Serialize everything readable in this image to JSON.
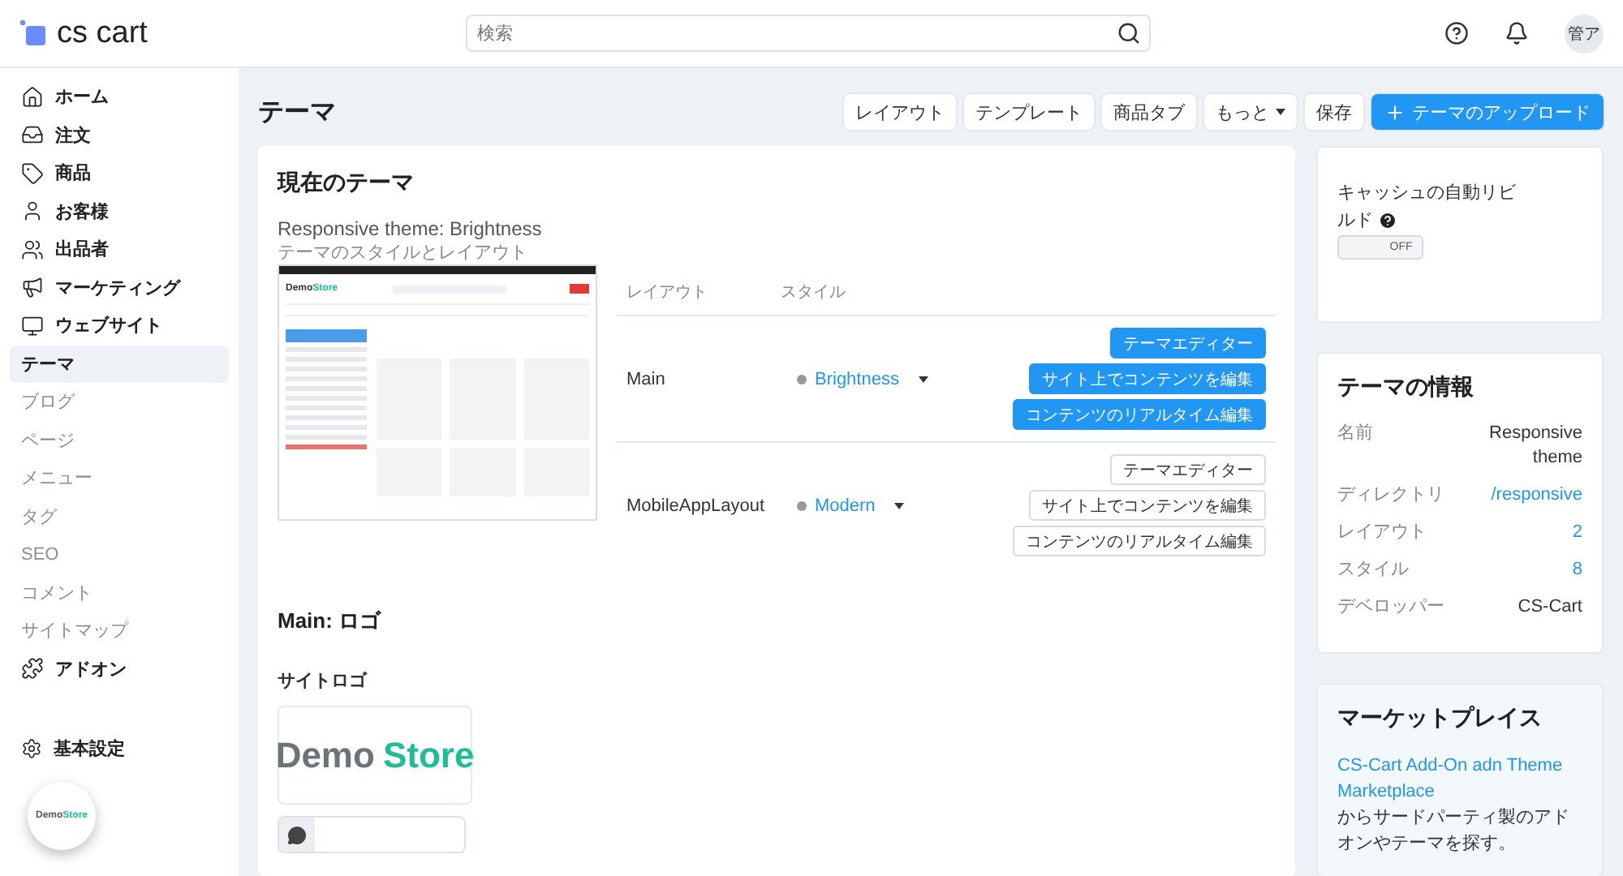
{
  "header": {
    "logo": "cs cart",
    "search": {
      "placeholder": "検索"
    },
    "avatar": "管ア"
  },
  "sidebar": {
    "items": [
      {
        "label": "ホーム",
        "kind": "main",
        "selected": false
      },
      {
        "label": "注文",
        "kind": "main",
        "selected": false
      },
      {
        "label": "商品",
        "kind": "main",
        "selected": false
      },
      {
        "label": "お客様",
        "kind": "main",
        "selected": false
      },
      {
        "label": "出品者",
        "kind": "main",
        "selected": false
      },
      {
        "label": "マーケティング",
        "kind": "main",
        "selected": false
      },
      {
        "label": "ウェブサイト",
        "kind": "main",
        "selected": false
      },
      {
        "label": "テーマ",
        "kind": "sub",
        "selected": true
      },
      {
        "label": "ブログ",
        "kind": "sub",
        "selected": false
      },
      {
        "label": "ページ",
        "kind": "sub",
        "selected": false
      },
      {
        "label": "メニュー",
        "kind": "sub",
        "selected": false
      },
      {
        "label": "タグ",
        "kind": "sub",
        "selected": false
      },
      {
        "label": "SEO",
        "kind": "sub",
        "selected": false
      },
      {
        "label": "コメント",
        "kind": "sub",
        "selected": false
      },
      {
        "label": "サイトマップ",
        "kind": "sub",
        "selected": false
      },
      {
        "label": "アドオン",
        "kind": "main",
        "selected": false
      }
    ],
    "settings": "基本設定",
    "store_badge": [
      "Demo",
      "Store"
    ]
  },
  "page": {
    "title": "テーマ",
    "toolbar": [
      {
        "label": "レイアウト",
        "kind": "plain"
      },
      {
        "label": "テンプレート",
        "kind": "plain"
      },
      {
        "label": "商品タブ",
        "kind": "plain"
      },
      {
        "label": "もっと",
        "kind": "dropdown"
      },
      {
        "label": "保存",
        "kind": "plain"
      },
      {
        "label": "テーマのアップロード",
        "kind": "primary"
      }
    ]
  },
  "current_theme": {
    "title": "現在のテーマ",
    "name": "Responsive theme: Brightness",
    "subtitle": "テーマのスタイルとレイアウト",
    "preview_logo": [
      "Demo",
      "Store"
    ],
    "columns": [
      "レイアウト",
      "スタイル"
    ],
    "rows": [
      {
        "layout": "Main",
        "style": "Brightness",
        "primary": true,
        "buttons": [
          "テーマエディター",
          "サイト上でコンテンツを編集",
          "コンテンツのリアルタイム編集"
        ]
      },
      {
        "layout": "MobileAppLayout",
        "style": "Modern",
        "primary": false,
        "buttons": [
          "テーマエディター",
          "サイト上でコンテンツを編集",
          "コンテンツのリアルタイム編集"
        ]
      }
    ]
  },
  "logo_section": {
    "title": "Main: ロゴ",
    "label": "サイトロゴ",
    "logo": [
      "Demo",
      "Store"
    ]
  },
  "cache": {
    "label": "キャッシュの自動リビルド",
    "toggle": {
      "on": false,
      "text": "OFF"
    }
  },
  "theme_info": {
    "title": "テーマの情報",
    "rows": [
      {
        "label": "名前",
        "value": "Responsive theme",
        "link": false
      },
      {
        "label": "ディレクトリ",
        "value": "/responsive",
        "link": true
      },
      {
        "label": "レイアウト",
        "value": "2",
        "link": true
      },
      {
        "label": "スタイル",
        "value": "8",
        "link": true
      },
      {
        "label": "デベロッパー",
        "value": "CS-Cart",
        "link": false
      }
    ]
  },
  "marketplace": {
    "title": "マーケットプレイス",
    "link": "CS-Cart Add-On adn Theme Marketplace",
    "text": " からサードパーティ製のアドオンやテーマを探す。"
  }
}
